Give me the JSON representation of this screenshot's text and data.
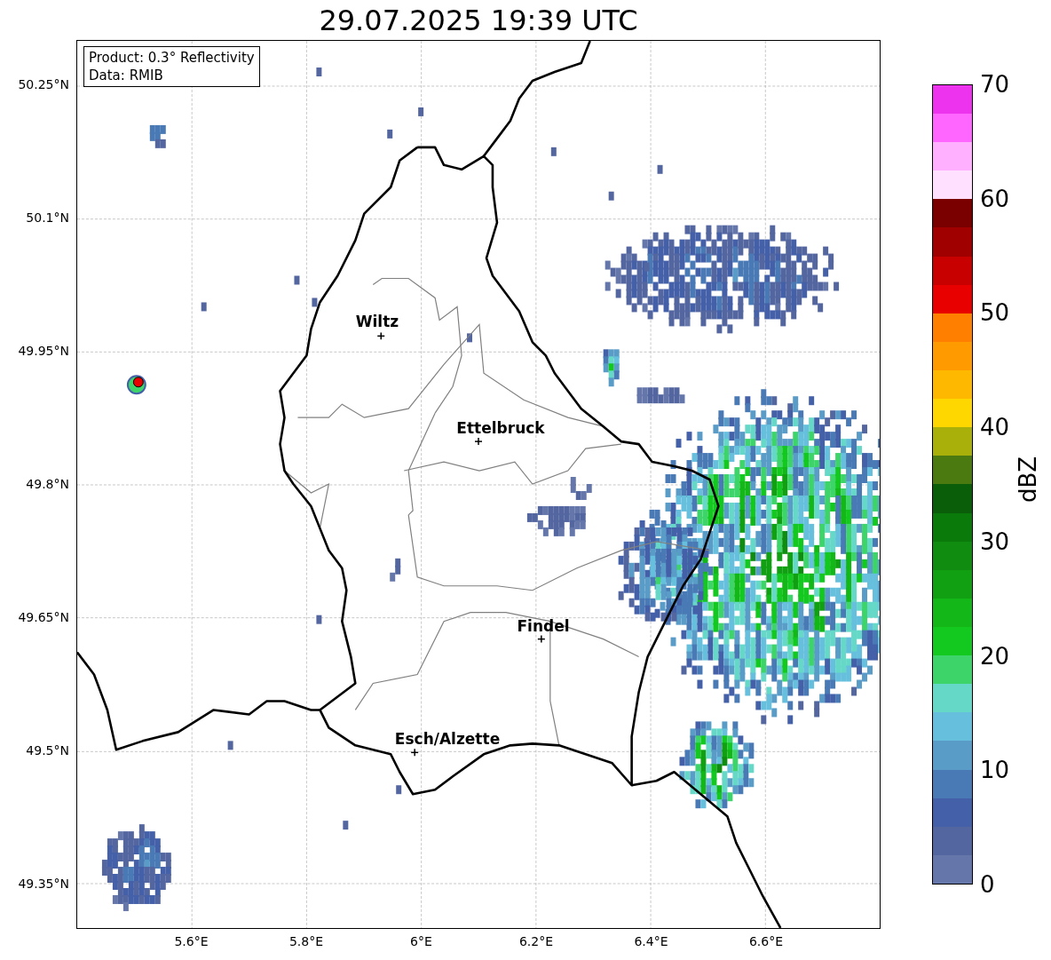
{
  "title": "29.07.2025 19:39 UTC",
  "info_box": {
    "lines": [
      "Product: 0.3° Reflectivity",
      "Data: RMIB"
    ]
  },
  "map": {
    "yticks": [
      "50.25°N",
      "50.1°N",
      "49.95°N",
      "49.8°N",
      "49.65°N",
      "49.5°N",
      "49.35°N"
    ],
    "xticks": [
      "5.6°E",
      "5.8°E",
      "6°E",
      "6.2°E",
      "6.4°E",
      "6.6°E"
    ],
    "cities": [
      {
        "name": "Wiltz"
      },
      {
        "name": "Ettelbruck"
      },
      {
        "name": "Findel"
      },
      {
        "name": "Esch/Alzette"
      }
    ]
  },
  "colorbar": {
    "label": "dBZ",
    "ticks": [
      "70",
      "60",
      "50",
      "40",
      "30",
      "20",
      "10",
      "0"
    ],
    "bins": [
      {
        "color": "#6577aa"
      },
      {
        "color": "#5466a0"
      },
      {
        "color": "#4460a8"
      },
      {
        "color": "#4a7ab5"
      },
      {
        "color": "#5a9cc8"
      },
      {
        "color": "#66c0dd"
      },
      {
        "color": "#66d8c8"
      },
      {
        "color": "#3dd46a"
      },
      {
        "color": "#13c81e"
      },
      {
        "color": "#13b818"
      },
      {
        "color": "#10a012"
      },
      {
        "color": "#108c10"
      },
      {
        "color": "#0a7a0a"
      },
      {
        "color": "#0a5e0a"
      },
      {
        "color": "#4a7a10"
      },
      {
        "color": "#aab00a"
      },
      {
        "color": "#ffd700"
      },
      {
        "color": "#ffb800"
      },
      {
        "color": "#ff9a00"
      },
      {
        "color": "#ff7f00"
      },
      {
        "color": "#e80000"
      },
      {
        "color": "#c80000"
      },
      {
        "color": "#a00000"
      },
      {
        "color": "#7a0000"
      },
      {
        "color": "#ffe0ff"
      },
      {
        "color": "#ffb0ff"
      },
      {
        "color": "#ff66ff"
      },
      {
        "color": "#ee33ee"
      }
    ]
  }
}
